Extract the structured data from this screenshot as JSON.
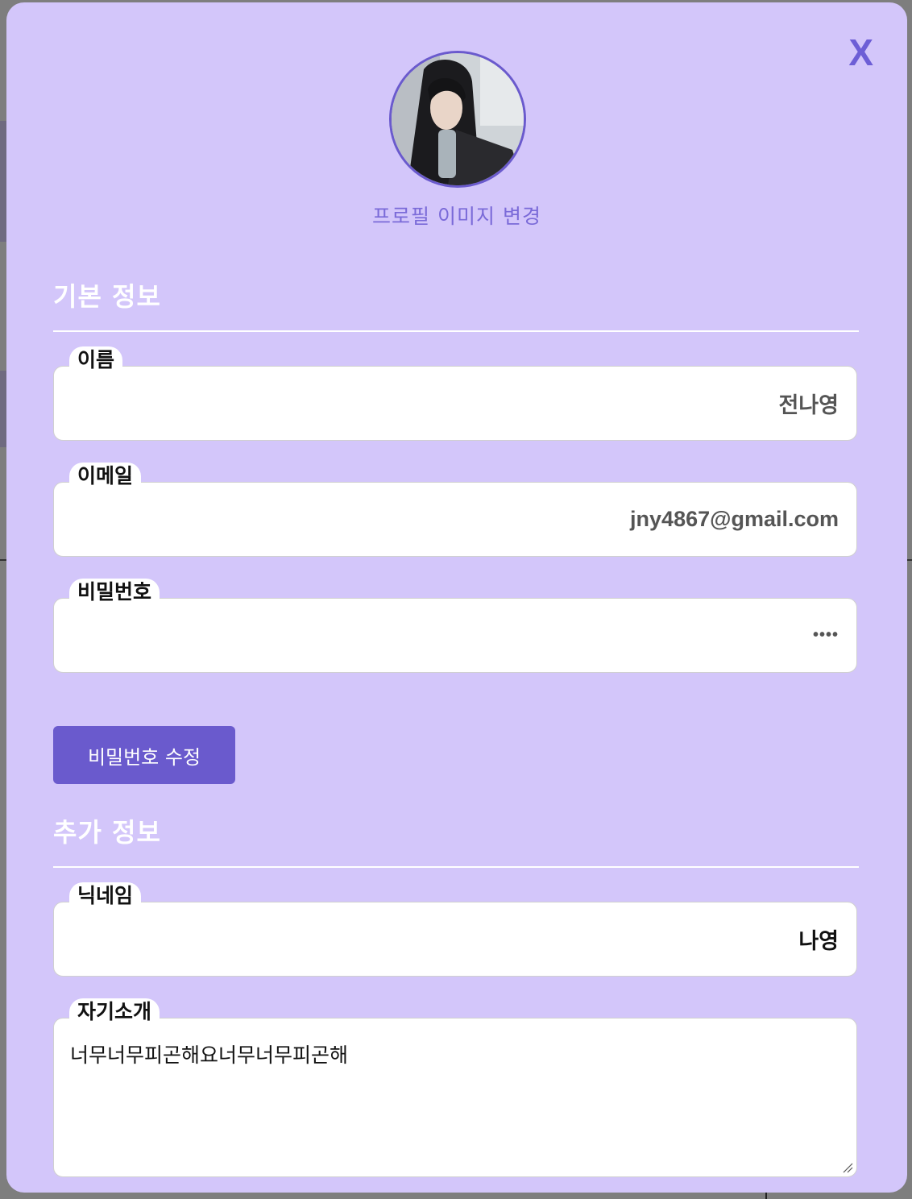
{
  "modal": {
    "close_label": "X",
    "change_image_label": "프로필 이미지 변경",
    "accent_color": "#6a5acd",
    "background_color": "#d3c6fa"
  },
  "basic_info": {
    "title": "기본 정보",
    "name": {
      "label": "이름",
      "value": "전나영"
    },
    "email": {
      "label": "이메일",
      "value": "jny4867@gmail.com"
    },
    "password": {
      "label": "비밀번호",
      "value": "••••"
    },
    "change_password_label": "비밀번호 수정"
  },
  "extra_info": {
    "title": "추가 정보",
    "nickname": {
      "label": "닉네임",
      "value": "나영"
    },
    "bio": {
      "label": "자기소개",
      "value": "너무너무피곤해요너무너무피곤해"
    }
  }
}
